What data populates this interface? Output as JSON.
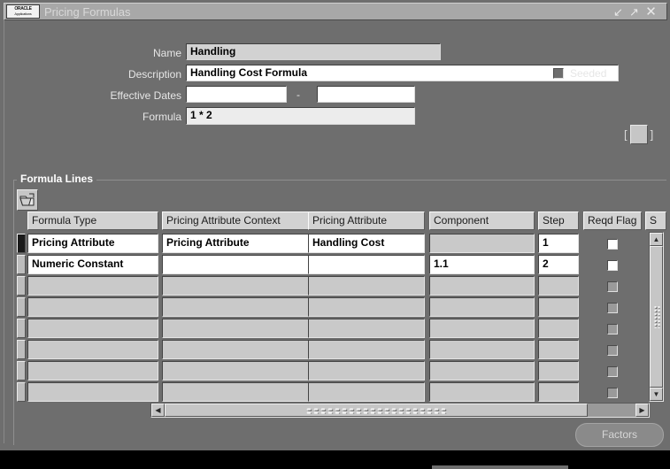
{
  "window": {
    "title": "Pricing Formulas",
    "logo_line1": "ORACLE",
    "logo_line2": "Applications",
    "controls": {
      "restore": "↙",
      "maximize": "↗",
      "close": "✕"
    }
  },
  "header_form": {
    "name_label": "Name",
    "name_value": "Handling",
    "description_label": "Description",
    "description_value": "Handling Cost Formula",
    "effective_dates_label": "Effective Dates",
    "effective_date_from": "",
    "effective_date_to": "",
    "date_separator": "-",
    "formula_label": "Formula",
    "formula_value": "1 * 2",
    "seeded_label": "Seeded",
    "seeded_checked": false,
    "lov_open_bracket": "[",
    "lov_close_bracket": "]"
  },
  "formula_lines": {
    "frame_title": "Formula Lines",
    "folder_icon": "folder-open-icon",
    "columns": [
      "Formula Type",
      "Pricing Attribute Context",
      "Pricing Attribute",
      "Component",
      "Step",
      "Reqd Flag",
      "S"
    ],
    "rows": [
      {
        "current": true,
        "formula_type": "Pricing Attribute",
        "formula_type_enabled": true,
        "pricing_attribute_context": "Pricing Attribute",
        "pricing_attribute_context_enabled": true,
        "pricing_attribute": "Handling Cost",
        "pricing_attribute_enabled": true,
        "component": "",
        "component_enabled": false,
        "step": "1",
        "step_enabled": true,
        "reqd_flag": false,
        "reqd_flag_enabled": true
      },
      {
        "current": false,
        "formula_type": "Numeric Constant",
        "formula_type_enabled": true,
        "pricing_attribute_context": "",
        "pricing_attribute_context_enabled": true,
        "pricing_attribute": "",
        "pricing_attribute_enabled": true,
        "component": "1.1",
        "component_enabled": true,
        "step": "2",
        "step_enabled": true,
        "reqd_flag": false,
        "reqd_flag_enabled": true
      },
      {
        "current": false,
        "formula_type": "",
        "formula_type_enabled": false,
        "pricing_attribute_context": "",
        "pricing_attribute_context_enabled": false,
        "pricing_attribute": "",
        "pricing_attribute_enabled": false,
        "component": "",
        "component_enabled": false,
        "step": "",
        "step_enabled": false,
        "reqd_flag": false,
        "reqd_flag_enabled": false
      },
      {
        "current": false,
        "formula_type": "",
        "formula_type_enabled": false,
        "pricing_attribute_context": "",
        "pricing_attribute_context_enabled": false,
        "pricing_attribute": "",
        "pricing_attribute_enabled": false,
        "component": "",
        "component_enabled": false,
        "step": "",
        "step_enabled": false,
        "reqd_flag": false,
        "reqd_flag_enabled": false
      },
      {
        "current": false,
        "formula_type": "",
        "formula_type_enabled": false,
        "pricing_attribute_context": "",
        "pricing_attribute_context_enabled": false,
        "pricing_attribute": "",
        "pricing_attribute_enabled": false,
        "component": "",
        "component_enabled": false,
        "step": "",
        "step_enabled": false,
        "reqd_flag": false,
        "reqd_flag_enabled": false
      },
      {
        "current": false,
        "formula_type": "",
        "formula_type_enabled": false,
        "pricing_attribute_context": "",
        "pricing_attribute_context_enabled": false,
        "pricing_attribute": "",
        "pricing_attribute_enabled": false,
        "component": "",
        "component_enabled": false,
        "step": "",
        "step_enabled": false,
        "reqd_flag": false,
        "reqd_flag_enabled": false
      },
      {
        "current": false,
        "formula_type": "",
        "formula_type_enabled": false,
        "pricing_attribute_context": "",
        "pricing_attribute_context_enabled": false,
        "pricing_attribute": "",
        "pricing_attribute_enabled": false,
        "component": "",
        "component_enabled": false,
        "step": "",
        "step_enabled": false,
        "reqd_flag": false,
        "reqd_flag_enabled": false
      },
      {
        "current": false,
        "formula_type": "",
        "formula_type_enabled": false,
        "pricing_attribute_context": "",
        "pricing_attribute_context_enabled": false,
        "pricing_attribute": "",
        "pricing_attribute_enabled": false,
        "component": "",
        "component_enabled": false,
        "step": "",
        "step_enabled": false,
        "reqd_flag": false,
        "reqd_flag_enabled": false
      }
    ]
  },
  "scrollbars": {
    "vertical_up": "▲",
    "vertical_down": "▼",
    "horizontal_left": "◀",
    "horizontal_right": "▶"
  },
  "footer": {
    "factors_label": "Factors"
  },
  "colors": {
    "window_background": "#6e6e6e",
    "titlebar": "#a8a8a8",
    "field_editable": "#ffffff",
    "field_readonly": "#d2d2d2",
    "header_cell": "#d2d2d2",
    "cell_disabled": "#c9c9c9",
    "current_row_marker": "#1a1a1a"
  }
}
